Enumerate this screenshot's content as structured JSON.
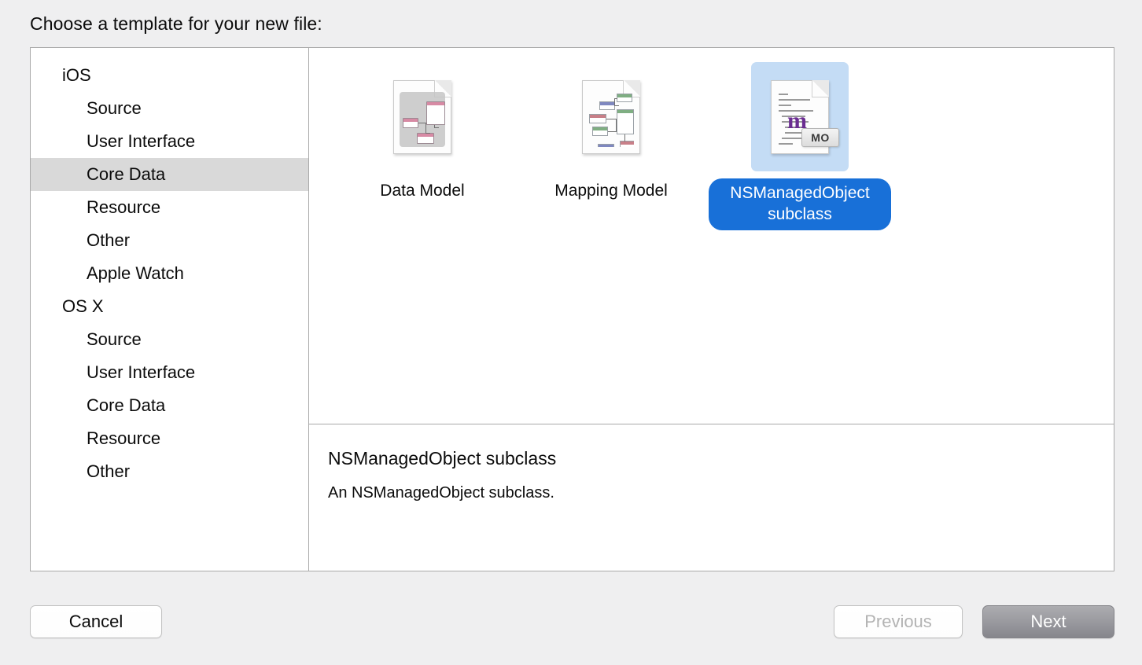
{
  "dialog": {
    "prompt": "Choose a template for your new file:"
  },
  "sidebar": {
    "groups": [
      {
        "name": "iOS",
        "items": [
          {
            "label": "Source",
            "selected": false
          },
          {
            "label": "User Interface",
            "selected": false
          },
          {
            "label": "Core Data",
            "selected": true
          },
          {
            "label": "Resource",
            "selected": false
          },
          {
            "label": "Other",
            "selected": false
          },
          {
            "label": "Apple Watch",
            "selected": false
          }
        ]
      },
      {
        "name": "OS X",
        "items": [
          {
            "label": "Source",
            "selected": false
          },
          {
            "label": "User Interface",
            "selected": false
          },
          {
            "label": "Core Data",
            "selected": false
          },
          {
            "label": "Resource",
            "selected": false
          },
          {
            "label": "Other",
            "selected": false
          }
        ]
      }
    ]
  },
  "templates": [
    {
      "label": "Data Model",
      "icon": "data-model-document-icon",
      "selected": false
    },
    {
      "label": "Mapping Model",
      "icon": "mapping-model-document-icon",
      "selected": false
    },
    {
      "label": "NSManagedObject subclass",
      "icon": "nsmanagedobject-subclass-document-icon",
      "badge": "MO",
      "glyph": "m",
      "selected": true
    }
  ],
  "description": {
    "title": "NSManagedObject subclass",
    "body": "An NSManagedObject subclass."
  },
  "footer": {
    "cancel_label": "Cancel",
    "previous_label": "Previous",
    "next_label": "Next"
  },
  "colors": {
    "window_background": "#efeff0",
    "panel_background": "#ffffff",
    "sidebar_selection": "#d9d9d9",
    "icon_selection": "#c4dcf5",
    "label_selection": "#1870d8",
    "default_button": "#9a9a9f",
    "glyph_purple": "#6b2d91"
  }
}
